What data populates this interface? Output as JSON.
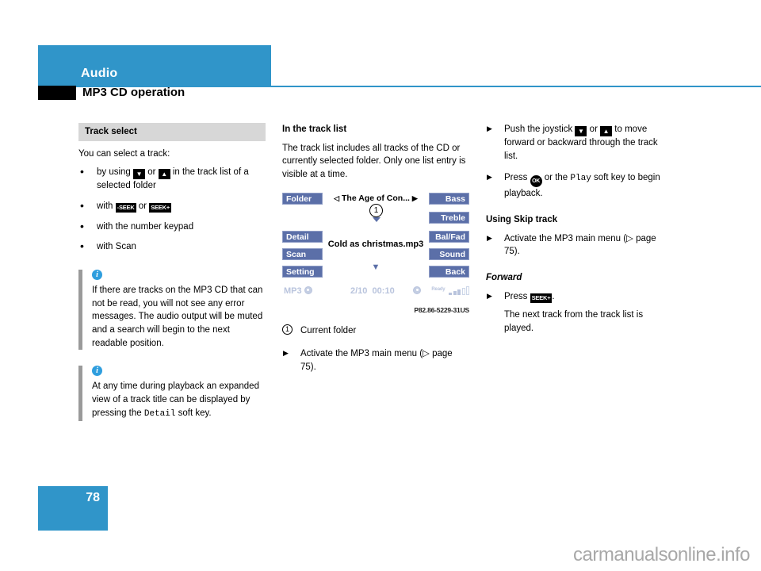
{
  "header": {
    "category": "Audio",
    "title": "MP3 CD operation"
  },
  "page_number": "78",
  "watermark": "carmanualsonline.info",
  "left_column": {
    "section_band": "Track select",
    "intro": "You can select a track:",
    "bullets": [
      {
        "before": "by using ",
        "key1": "▼",
        "mid": " or ",
        "key2": "▲",
        "after": " in the track list of a selected folder"
      },
      {
        "before": "with ",
        "key1": "-SEEK",
        "mid": " or ",
        "key2": "SEEK+",
        "after": ""
      },
      {
        "before": "with the number keypad",
        "key1": "",
        "mid": "",
        "key2": "",
        "after": ""
      },
      {
        "before": "with Scan",
        "key1": "",
        "mid": "",
        "key2": "",
        "after": ""
      }
    ],
    "notes": [
      {
        "icon": "info-icon",
        "text": "If there are tracks on the MP3 CD that can not be read, you will not see any error messages. The audio output will be muted and a search will begin to the next readable position."
      },
      {
        "icon": "info-icon",
        "text_a": "At any time during playback an expanded view of a track title can be displayed by pressing the ",
        "mono": "Detail",
        "text_b": " soft key."
      }
    ]
  },
  "middle_column": {
    "heading": "In the track list",
    "paragraph": "The track list includes all tracks of the CD or currently selected folder. Only one list entry is visible at a time.",
    "display": {
      "left_keys": [
        "Folder",
        "Detail",
        "Scan",
        "Setting"
      ],
      "right_keys": [
        "Bass",
        "Treble",
        "Bal/Fad",
        "Sound",
        "Back"
      ],
      "title_prev_arrow": "◁",
      "title": "The Age of Con...",
      "title_next_arrow": "▶",
      "callout_number": "1",
      "track_name": "Cold as christmas.mp3",
      "down_arrow": "▼",
      "status_mode": "MP3",
      "status_track": "2/10",
      "status_time": "00:10",
      "signal_label": "Ready",
      "signal_bars_filled": 3,
      "signal_bars_empty": 2
    },
    "figure_code": "P82.86-5229-31US",
    "legend": [
      {
        "marker": "1",
        "text": "Current folder"
      }
    ],
    "steps": [
      {
        "text_a": "Activate the MP3 main menu (",
        "ref_arrow": "▷",
        "text_b": " page 75)."
      }
    ]
  },
  "right_column": {
    "steps_top": [
      {
        "before": "Push the joystick ",
        "key1": "▼",
        "mid": " or ",
        "key2": "▲",
        "after": " to move forward or backward through the track list."
      },
      {
        "before": "Press ",
        "ok_key": "OK",
        "mid": " or the ",
        "mono": "Play",
        "after": " soft key to begin playback."
      }
    ],
    "heading_skip": "Using Skip track",
    "skip_step": {
      "text_a": "Activate the MP3 main menu (",
      "ref_arrow": "▷",
      "text_b": " page 75)."
    },
    "heading_forward": "Forward",
    "forward_step": {
      "before": "Press ",
      "key": "SEEK+",
      "after": "."
    },
    "forward_result": "The next track from the track list is played."
  }
}
